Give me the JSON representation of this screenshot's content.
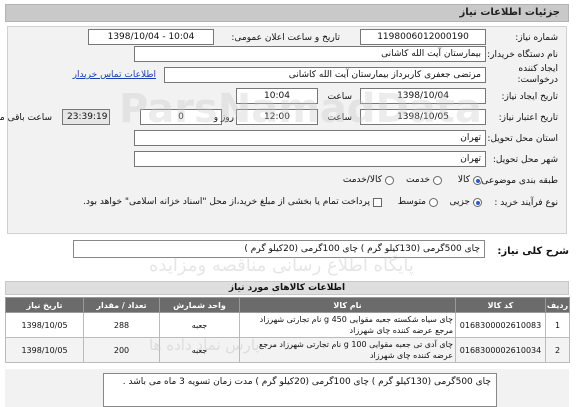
{
  "header": {
    "title": "جزئیات اطلاعات نیاز"
  },
  "form": {
    "need_number_label": "شماره نیاز:",
    "need_number": "1198006012000190",
    "announce_label": "تاریخ و ساعت اعلان عمومی:",
    "announce_value": "1398/10/04 - 10:04",
    "device_label": "نام دستگاه خریدار:",
    "device_value": "بیمارستان آیت الله کاشانی",
    "creator_label_1": "ایجاد کننده",
    "creator_label_2": "درخواست:",
    "creator_value": "مرتضی جعفری کاربرداز بیمارستان آیت الله کاشانی",
    "contact_link": "اطلاعات تماس خریدار",
    "create_date_label": "تاریخ ایجاد نیاز:",
    "create_date": "1398/10/04",
    "time_label": "ساعت",
    "create_time": "10:04",
    "deadline_label": "تاریخ اعتبار نیاز:",
    "deadline_date": "1398/10/05",
    "deadline_time": "12:00",
    "days_label": "روز و",
    "days_value": "0",
    "remaining_time": "23:39:19",
    "remaining_label": "ساعت باقی مانده",
    "province_label": "استان محل تحویل:",
    "province_value": "تهران",
    "city_label": "شهر محل تحویل:",
    "city_value": "تهران",
    "category_label": "طبقه بندی موضوعی:",
    "category_options": [
      "کالا",
      "خدمت",
      "کالا/خدمت"
    ],
    "category_selected": "کالا",
    "purchase_type_label": "نوع فرآیند خرید :",
    "purchase_options": [
      "جزیی",
      "متوسط"
    ],
    "purchase_selected": "جزیی",
    "payment_note": "پرداخت تمام یا بخشی از مبلغ خرید،از محل \"اسناد خزانه اسلامی\" خواهد بود."
  },
  "summary": {
    "label": "شرح کلی نیاز:",
    "text": "چای 500گرمی (130کیلو گرم ) چای 100گرمی (20کیلو گرم )"
  },
  "items_section": {
    "title": "اطلاعات کالاهای مورد نیاز"
  },
  "items_table": {
    "headers": [
      "ردیف",
      "کد کالا",
      "نام کالا",
      "واحد شمارش",
      "تعداد / مقدار",
      "تاریخ نیاز"
    ],
    "rows": [
      {
        "row": "1",
        "code": "0168300002610083",
        "name": "چای سیاه شکسته جعبه مقوایی 450 g نام تجارتی شهرزاد مرجع عرضه کننده چای شهرزاد",
        "unit": "جعبه",
        "qty": "288",
        "date": "1398/10/05"
      },
      {
        "row": "2",
        "code": "0168300002610034",
        "name": "چای آدی تی جعبه مقوایی 100 g نام تجارتی شهرزاد مرجع عرضه کننده چای شهرزاد",
        "unit": "جعبه",
        "qty": "200",
        "date": "1398/10/05"
      }
    ]
  },
  "buyer_notes": {
    "text": "چای 500گرمی (130کیلو گرم ) چای 100گرمی (20کیلو گرم ) مدت زمان تسویه 3 ماه می باشد ."
  },
  "watermarks": {
    "main": "ParsNamadData",
    "mid": "پایگاه اطلاع رسانی مناقصه ومزایده",
    "bottom": "پارس نماد داده ها"
  }
}
